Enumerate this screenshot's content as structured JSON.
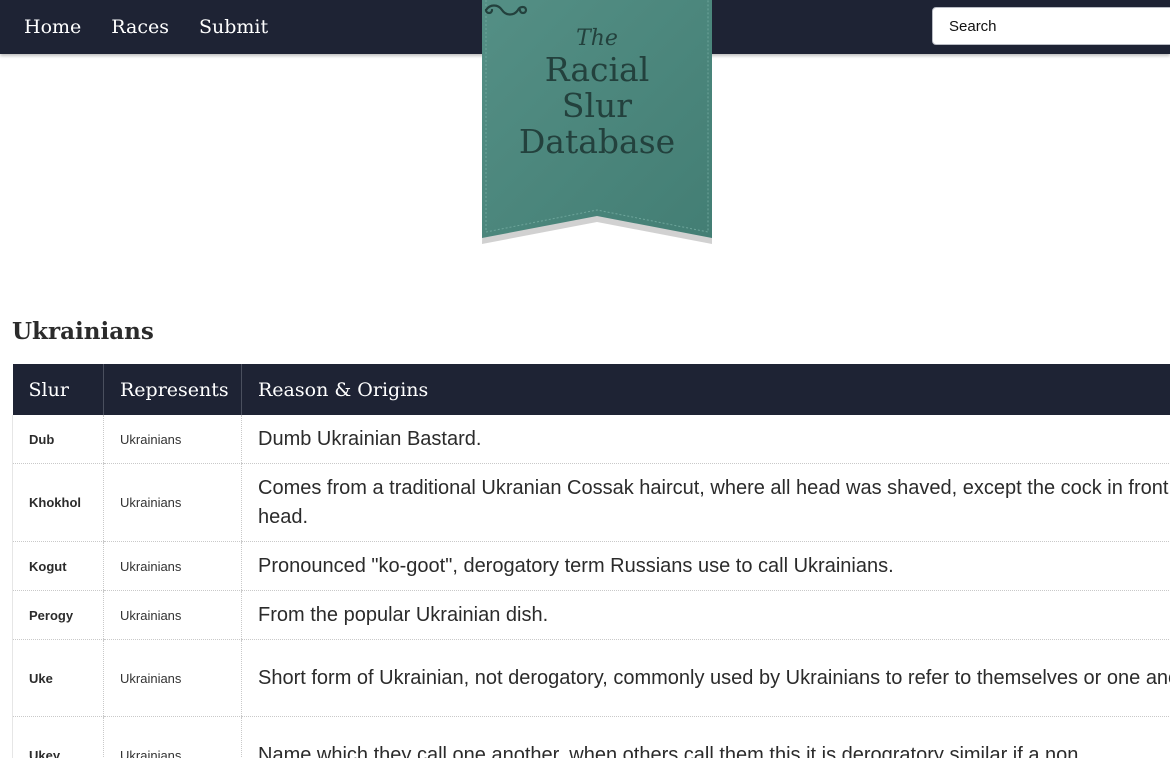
{
  "nav": {
    "items": [
      {
        "label": "Home"
      },
      {
        "label": "Races"
      },
      {
        "label": "Submit"
      }
    ],
    "search_placeholder": "Search"
  },
  "logo": {
    "the": "The",
    "line1": "Racial",
    "line2": "Slur",
    "line3": "Database",
    "flourish_icon": "flourish-ornament",
    "ribbon_color": "#4b8a7f",
    "text_color": "#23413d"
  },
  "section": {
    "title": "Ukrainians"
  },
  "table": {
    "columns": [
      "Slur",
      "Represents",
      "Reason & Origins"
    ],
    "rows": [
      {
        "slur": "Dub",
        "represents": "Ukrainians",
        "reason": "Dumb Ukrainian Bastard."
      },
      {
        "slur": "Khokhol",
        "represents": "Ukrainians",
        "reason": "Comes from a traditional Ukranian Cossak haircut, where all head was shaved, except the cock in front of the head."
      },
      {
        "slur": "Kogut",
        "represents": "Ukrainians",
        "reason": "Pronounced \"ko-goot\", derogatory term Russians use to call Ukrainians."
      },
      {
        "slur": "Perogy",
        "represents": "Ukrainians",
        "reason": "From the popular Ukrainian dish."
      },
      {
        "slur": "Uke",
        "represents": "Ukrainians",
        "reason": "Short form of Ukrainian, not derogatory, commonly used by Ukrainians to refer to themselves or one another."
      },
      {
        "slur": "Ukey",
        "represents": "Ukrainians",
        "reason": "Name which they call one another, when others call them this it is derogratory similar if a non"
      }
    ]
  },
  "colors": {
    "navbar": "#1e2334",
    "header_text": "#ffffff"
  }
}
